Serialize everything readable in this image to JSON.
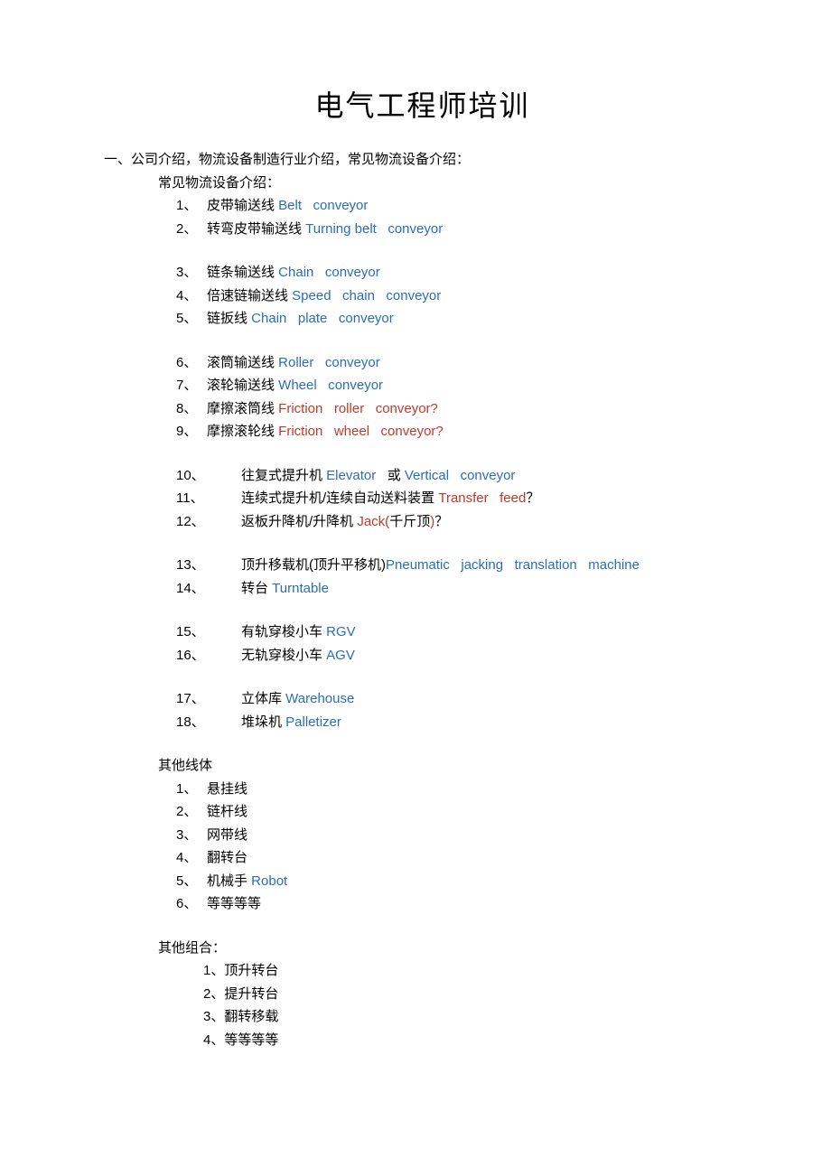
{
  "title": "电气工程师培训",
  "section1": "一、公司介绍，物流设备制造行业介绍，常见物流设备介绍：",
  "sub1": "常见物流设备介绍：",
  "groupA": [
    {
      "num": "1、",
      "cn": "皮带输送线 ",
      "enBlue": "Belt   conveyor"
    },
    {
      "num": "2、",
      "cn": "转弯皮带输送线 ",
      "enBlue": "Turning belt   conveyor"
    }
  ],
  "groupB": [
    {
      "num": "3、",
      "cn": "链条输送线 ",
      "enBlue": "Chain   conveyor"
    },
    {
      "num": "4、",
      "cn": "倍速链输送线 ",
      "enBlue": "Speed   chain   conveyor"
    },
    {
      "num": "5、",
      "cn": "链扳线 ",
      "enBlue": "Chain   plate   conveyor"
    }
  ],
  "groupC": [
    {
      "num": "6、",
      "cn": "滚筒输送线 ",
      "enBlue": "Roller   conveyor"
    },
    {
      "num": "7、",
      "cn": "滚轮输送线 ",
      "enBlue": "Wheel   conveyor"
    },
    {
      "num": "8、",
      "cn": "摩擦滚筒线 ",
      "enRed": "Friction   roller   conveyor?"
    },
    {
      "num": "9、",
      "cn": "摩擦滚轮线 ",
      "enRed": "Friction   wheel   conveyor?"
    }
  ],
  "groupD": [
    {
      "num": "10、",
      "cn": "往复式提升机 ",
      "parts": [
        {
          "cls": "blue",
          "t": "Elevator   "
        },
        {
          "cls": "",
          "t": "或 "
        },
        {
          "cls": "blue",
          "t": "Vertical   conveyor"
        }
      ]
    },
    {
      "num": "11、",
      "cn": "连续式提升机/连续自动送料装置 ",
      "parts": [
        {
          "cls": "red",
          "t": "Transfer   feed"
        },
        {
          "cls": "",
          "t": "？"
        }
      ]
    },
    {
      "num": "12、",
      "cn": "返板升降机/升降机 ",
      "parts": [
        {
          "cls": "red",
          "t": "Jack("
        },
        {
          "cls": "",
          "t": "千斤顶"
        },
        {
          "cls": "red",
          "t": ")"
        },
        {
          "cls": "",
          "t": "？"
        }
      ]
    }
  ],
  "groupE": [
    {
      "num": "13、",
      "cn": "顶升移载机(顶升平移机)",
      "enBlue": "Pneumatic   jacking   translation   machine"
    },
    {
      "num": "14、",
      "cn": "转台 ",
      "enBlue": "Turntable"
    }
  ],
  "groupF": [
    {
      "num": "15、",
      "cn": "有轨穿梭小车 ",
      "enBlue": "RGV"
    },
    {
      "num": "16、",
      "cn": "无轨穿梭小车 ",
      "enBlue": "AGV"
    }
  ],
  "groupG": [
    {
      "num": "17、",
      "cn": "立体库 ",
      "enBlue": "Warehouse"
    },
    {
      "num": "18、",
      "cn": "堆垛机 ",
      "enBlue": "Palletizer"
    }
  ],
  "other_title": "其他线体",
  "other": [
    {
      "num": "1、",
      "cn": "悬挂线"
    },
    {
      "num": "2、",
      "cn": "链杆线"
    },
    {
      "num": "3、",
      "cn": "网带线"
    },
    {
      "num": "4、",
      "cn": "翻转台"
    },
    {
      "num": "5、",
      "cn": "机械手 ",
      "enBlue": "Robot"
    },
    {
      "num": "6、",
      "cn": "等等等等"
    }
  ],
  "combo_title": "其他组合：",
  "combo": [
    {
      "num": "1、",
      "cn": "顶升转台"
    },
    {
      "num": "2、",
      "cn": "提升转台"
    },
    {
      "num": "3、",
      "cn": "翻转移载"
    },
    {
      "num": "4、",
      "cn": "等等等等"
    }
  ]
}
